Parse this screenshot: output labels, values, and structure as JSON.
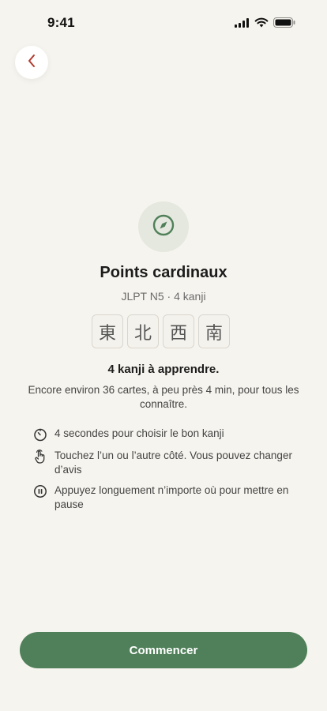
{
  "status_bar": {
    "time": "9:41",
    "icons": [
      "cellular-signal-icon",
      "wifi-icon",
      "battery-icon"
    ]
  },
  "nav": {
    "back_icon": "chevron-left-icon"
  },
  "deck": {
    "icon": "compass-icon",
    "title": "Points cardinaux",
    "subtitle": "JLPT N5 · 4 kanji",
    "kanji": [
      "東",
      "北",
      "西",
      "南"
    ]
  },
  "summary": {
    "heading": "4 kanji à apprendre.",
    "description": "Encore environ 36 cartes, à peu près 4 min, pour tous les connaître."
  },
  "tips": [
    {
      "icon": "timer-icon",
      "text": "4 secondes pour choisir le bon kanji"
    },
    {
      "icon": "tap-hand-icon",
      "text": "Touchez l’un ou l’autre côté. Vous pouvez changer d’avis"
    },
    {
      "icon": "pause-icon",
      "text": "Appuyez longuement n’importe où pour mettre en pause"
    }
  ],
  "actions": {
    "start_label": "Commencer"
  },
  "colors": {
    "background": "#f6f4ee",
    "accent": "#4f8059",
    "back_chevron": "#b23a2e"
  }
}
